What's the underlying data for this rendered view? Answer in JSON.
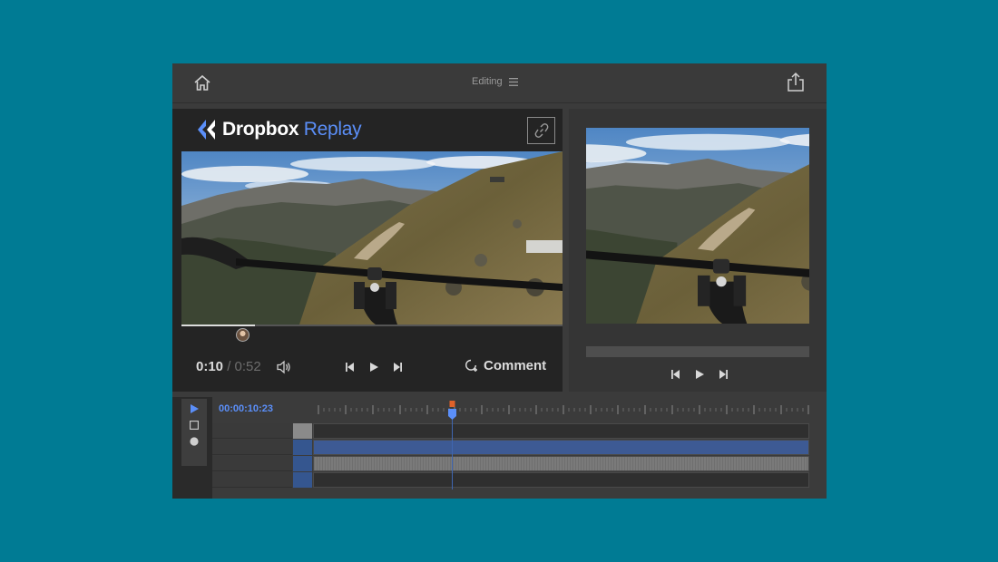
{
  "header": {
    "mode_label": "Editing",
    "home_icon": "home-icon",
    "menu_icon": "menu-icon",
    "share_icon": "share-icon"
  },
  "brand": {
    "name": "Dropbox",
    "product": "Replay",
    "accent_color": "#5b8ff9"
  },
  "player": {
    "current_time": "0:10",
    "separator": "/",
    "duration": "0:52",
    "progress": 0.192,
    "comment_label": "Comment",
    "link_icon": "link-icon",
    "volume_icon": "volume-icon",
    "comment_icon": "comment-icon",
    "controls": [
      "step-back-icon",
      "play-icon",
      "step-forward-icon"
    ]
  },
  "preview": {
    "controls": [
      "step-back-icon",
      "play-icon",
      "step-forward-icon"
    ]
  },
  "timeline": {
    "timecode": "00:00:10:23",
    "tools": [
      "select-tool-icon",
      "rectangle-tool-icon",
      "circle-tool-icon"
    ],
    "tracks": [
      {
        "name": "track-1",
        "style": "empty"
      },
      {
        "name": "track-2",
        "style": "blue"
      },
      {
        "name": "track-3",
        "style": "gray"
      },
      {
        "name": "track-4",
        "style": "empty"
      }
    ]
  },
  "colors": {
    "background": "#007b94",
    "clip_blue": "#3d5a94",
    "playhead_marker": "#e0622a"
  }
}
